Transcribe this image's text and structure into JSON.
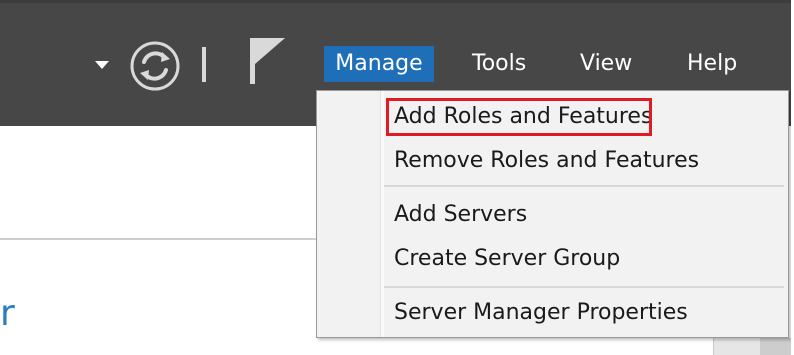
{
  "toolbar": {
    "icons": {
      "dropdown": "chevron-down-icon",
      "refresh": "refresh-icon",
      "separator": "separator",
      "flag": "flag-icon"
    },
    "colors": {
      "header_bg": "#474747",
      "active_menu_bg": "#1e6fb7",
      "text": "#ffffff"
    }
  },
  "menu_bar": {
    "items": [
      {
        "label": "Manage",
        "active": true
      },
      {
        "label": "Tools"
      },
      {
        "label": "View"
      },
      {
        "label": "Help"
      }
    ]
  },
  "manage_menu": {
    "items": [
      {
        "label": "Add Roles and Features",
        "highlighted": true
      },
      {
        "label": "Remove Roles and Features"
      },
      {
        "label": "Add Servers"
      },
      {
        "label": "Create Server Group"
      },
      {
        "label": "Server Manager Properties"
      }
    ],
    "highlight_color": "#e01b24"
  },
  "content": {
    "partial_title": "r",
    "title_color": "#2a7dc4"
  }
}
